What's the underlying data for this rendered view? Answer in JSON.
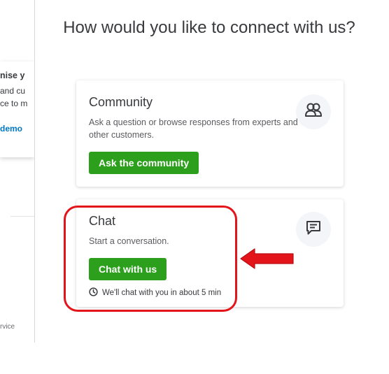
{
  "background_page": {
    "heading_fragment": "nise y",
    "line1_fragment": "and cu",
    "line2_fragment": "ce to m",
    "link_fragment": "demo",
    "footer_fragment": "rvice"
  },
  "title": "How would you like to connect with us?",
  "community": {
    "title": "Community",
    "description": "Ask a question or browse responses from experts and other customers.",
    "button_label": "Ask the community",
    "icon": "people-icon"
  },
  "chat": {
    "title": "Chat",
    "description": "Start a conversation.",
    "button_label": "Chat with us",
    "wait_text": "We'll chat with you in about 5 min",
    "icon": "chat-icon"
  },
  "colors": {
    "accent_green": "#2ca01c",
    "annotation_red": "#e4141b",
    "link_blue": "#0077c5"
  }
}
